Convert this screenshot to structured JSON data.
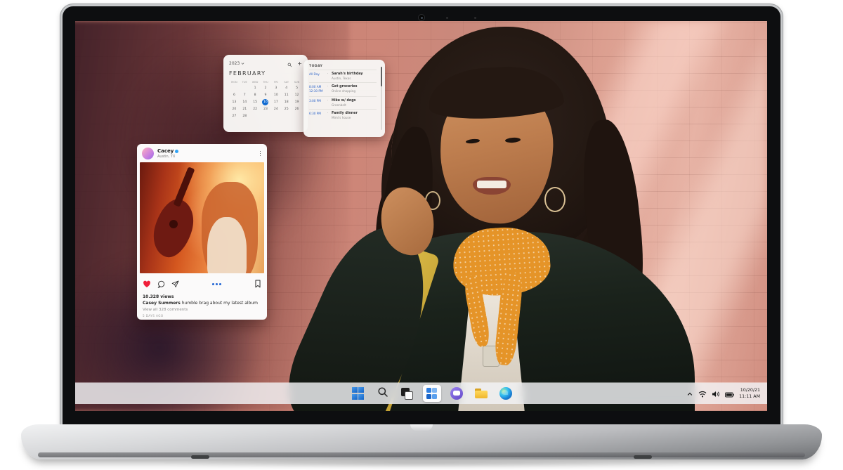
{
  "colors": {
    "accent_blue": "#0f6ad1",
    "verified_blue": "#31a3f5",
    "heart_red": "#f01f3a",
    "chat_purple": "#6348c8",
    "folder_yellow": "#efb62c"
  },
  "calendar_widget": {
    "year_label": "2023",
    "month": "FEBRUARY",
    "day_headers": [
      "MON",
      "TUE",
      "WED",
      "THU",
      "FRI",
      "SAT",
      "SUN"
    ],
    "weeks": [
      [
        "",
        "",
        "1",
        "2",
        "3",
        "4",
        "5"
      ],
      [
        "6",
        "7",
        "8",
        "9",
        "10",
        "11",
        "12"
      ],
      [
        "13",
        "14",
        "15",
        "16",
        "17",
        "18",
        "19"
      ],
      [
        "20",
        "21",
        "22",
        "23",
        "24",
        "25",
        "26"
      ],
      [
        "27",
        "28",
        "",
        "",
        "",
        "",
        ""
      ]
    ],
    "selected_day": "16",
    "add_button_label": "+"
  },
  "agenda_widget": {
    "header": "TODAY",
    "events": [
      {
        "time1": "All Day",
        "time2": "",
        "title": "Sarah's birthday",
        "subtitle": "Austin, Texas"
      },
      {
        "time1": "8:00 AM",
        "time2": "12:30 PM",
        "title": "Get groceries",
        "subtitle": "Online shopping"
      },
      {
        "time1": "3:00 PM",
        "time2": "",
        "title": "Hike w/ dogs",
        "subtitle": "Greenbelt"
      },
      {
        "time1": "6:30 PM",
        "time2": "",
        "title": "Family dinner",
        "subtitle": "Mimi's house"
      }
    ]
  },
  "social_post": {
    "username": "Cacey",
    "location": "Austin, TX",
    "views_label": "10.328 views",
    "author": "Casey Summers",
    "caption": "humble brag about my latest album",
    "comments_link": "View all 328 comments",
    "posted_label": "5 DAYS AGO"
  },
  "taskbar": {
    "buttons": [
      "windows-start",
      "search",
      "task-view",
      "widgets",
      "chat",
      "file-explorer",
      "edge"
    ],
    "active_button": "widgets",
    "tray": {
      "date": "10/20/21",
      "time": "11:11 AM"
    }
  }
}
